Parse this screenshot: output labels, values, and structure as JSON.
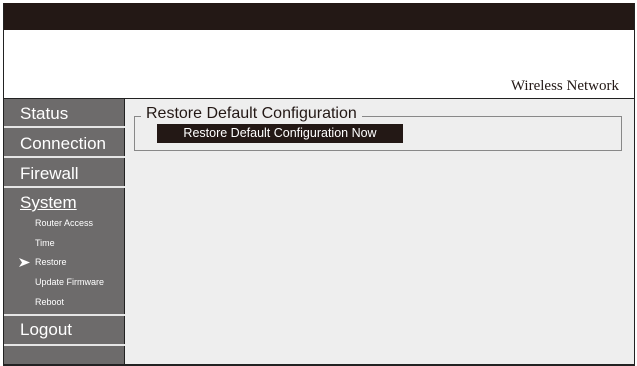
{
  "header": {
    "brand": "Wireless Network"
  },
  "sidebar": {
    "main": [
      "Status",
      "Connection",
      "Firewall",
      "System",
      "Logout"
    ],
    "sub": [
      "Router Access",
      "Time",
      "Restore",
      "Update Firmware",
      "Reboot"
    ],
    "active_sub": "Restore"
  },
  "content": {
    "panel_title": "Restore Default Configuration",
    "button_label": "Restore Default Configuration Now"
  }
}
